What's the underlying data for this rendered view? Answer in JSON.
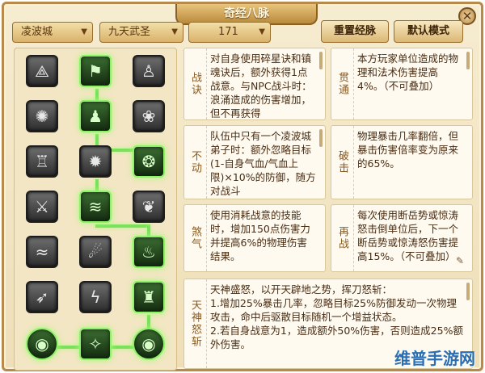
{
  "window": {
    "title": "奇经八脉",
    "close_symbol": "✕"
  },
  "toolbar": {
    "school": "凌波城",
    "skill": "九天武圣",
    "level": "171",
    "reset_button": "重置经脉",
    "default_button": "默认模式"
  },
  "talents": [
    {
      "label": "战诀",
      "text": "对自身使用碎星诀和镇魂诀后，额外获得1点战意。与NPC战斗时：浪涌造成的伤害增加，但不再获得"
    },
    {
      "label": "贯通",
      "text": "本方玩家单位造成的物理和法术伤害提高4%。（不可叠加）"
    },
    {
      "label": "不动",
      "text": "队伍中只有一个凌波城弟子时：额外忽略目标(1-自身气血/气血上限)×10%的防御，随方对战斗"
    },
    {
      "label": "破击",
      "text": "物理暴击几率翻倍，但暴击伤害倍率变为原来的65%。"
    },
    {
      "label": "煞气",
      "text": "使用消耗战意的技能时，增加150点伤害力并提高6%的物理伤害结果。"
    },
    {
      "label": "再战",
      "text": "每次使用断岳势或惊涛怒击倒单位后，下一个断岳势或惊涛怒伤害提高15%。（不可叠加）"
    },
    {
      "label": "天神怒斩",
      "text": "天神盛怒，以开天辟地之势，挥刀怒斩：\n1.增加25%暴击几率，忽略目标25%防御发动一次物理攻击，命中后驱散目标随机一个增益状态。\n2.若自身战意为1，造成额外50%伤害，否则造成25%额外伤害。"
    }
  ],
  "nodes": [
    {
      "icon": "wolf-icon",
      "glyph": "⟁",
      "active": false
    },
    {
      "icon": "banner-icon",
      "glyph": "⚑",
      "active": true
    },
    {
      "icon": "warrior-icon",
      "glyph": "♙",
      "active": false
    },
    {
      "icon": "swirl-icon",
      "glyph": "✺",
      "active": false
    },
    {
      "icon": "figure-icon",
      "glyph": "♟",
      "active": true
    },
    {
      "icon": "wind-icon",
      "glyph": "❀",
      "active": false
    },
    {
      "icon": "strong-man-icon",
      "glyph": "♖",
      "active": false
    },
    {
      "icon": "sun-icon",
      "glyph": "✹",
      "active": false
    },
    {
      "icon": "beast-icon",
      "glyph": "❂",
      "active": true
    },
    {
      "icon": "blade-icon",
      "glyph": "⚔",
      "active": false
    },
    {
      "icon": "surge-icon",
      "glyph": "≋",
      "active": true
    },
    {
      "icon": "dragon-icon",
      "glyph": "❦",
      "active": false
    },
    {
      "icon": "waves-icon",
      "glyph": "≈",
      "active": false
    },
    {
      "icon": "strike-icon",
      "glyph": "☄",
      "active": false
    },
    {
      "icon": "flame-icon",
      "glyph": "♨",
      "active": true
    },
    {
      "icon": "arrows-icon",
      "glyph": "➶",
      "active": false
    },
    {
      "icon": "lightning-icon",
      "glyph": "ϟ",
      "active": false
    },
    {
      "icon": "titan-icon",
      "glyph": "♜",
      "active": true
    },
    {
      "icon": "orb-left-icon",
      "glyph": "◉",
      "active": true,
      "round": true
    },
    {
      "icon": "orb-mid-icon",
      "glyph": "✧",
      "active": true
    },
    {
      "icon": "orb-right-icon",
      "glyph": "◉",
      "active": true,
      "round": true
    }
  ],
  "footer_text": "维普手游网",
  "watermark": "维普手游网"
}
